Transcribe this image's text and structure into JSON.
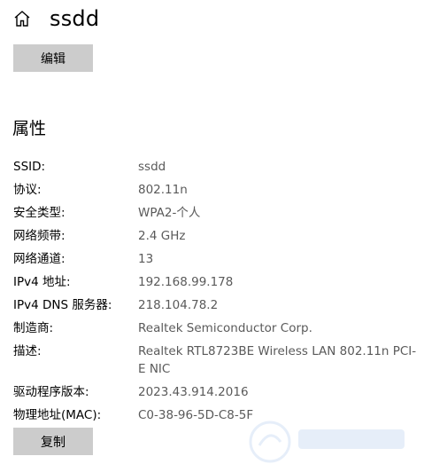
{
  "header": {
    "title": "ssdd",
    "home_icon": "home-icon"
  },
  "buttons": {
    "edit_label": "编辑",
    "copy_label": "复制"
  },
  "properties": {
    "heading": "属性",
    "rows": [
      {
        "label": "SSID:",
        "value": "ssdd"
      },
      {
        "label": "协议:",
        "value": "802.11n"
      },
      {
        "label": "安全类型:",
        "value": "WPA2-个人"
      },
      {
        "label": "网络频带:",
        "value": "2.4 GHz"
      },
      {
        "label": "网络通道:",
        "value": "13"
      },
      {
        "label": "IPv4 地址:",
        "value": "192.168.99.178"
      },
      {
        "label": "IPv4 DNS 服务器:",
        "value": "218.104.78.2"
      },
      {
        "label": "制造商:",
        "value": "Realtek Semiconductor Corp."
      },
      {
        "label": "描述:",
        "value": "Realtek RTL8723BE Wireless LAN 802.11n PCI-E NIC"
      },
      {
        "label": "驱动程序版本:",
        "value": "2023.43.914.2016"
      },
      {
        "label": "物理地址(MAC):",
        "value": "C0-38-96-5D-C8-5F"
      }
    ]
  },
  "colors": {
    "button_bg": "#cccccc",
    "value_text": "#5a5a5a"
  }
}
